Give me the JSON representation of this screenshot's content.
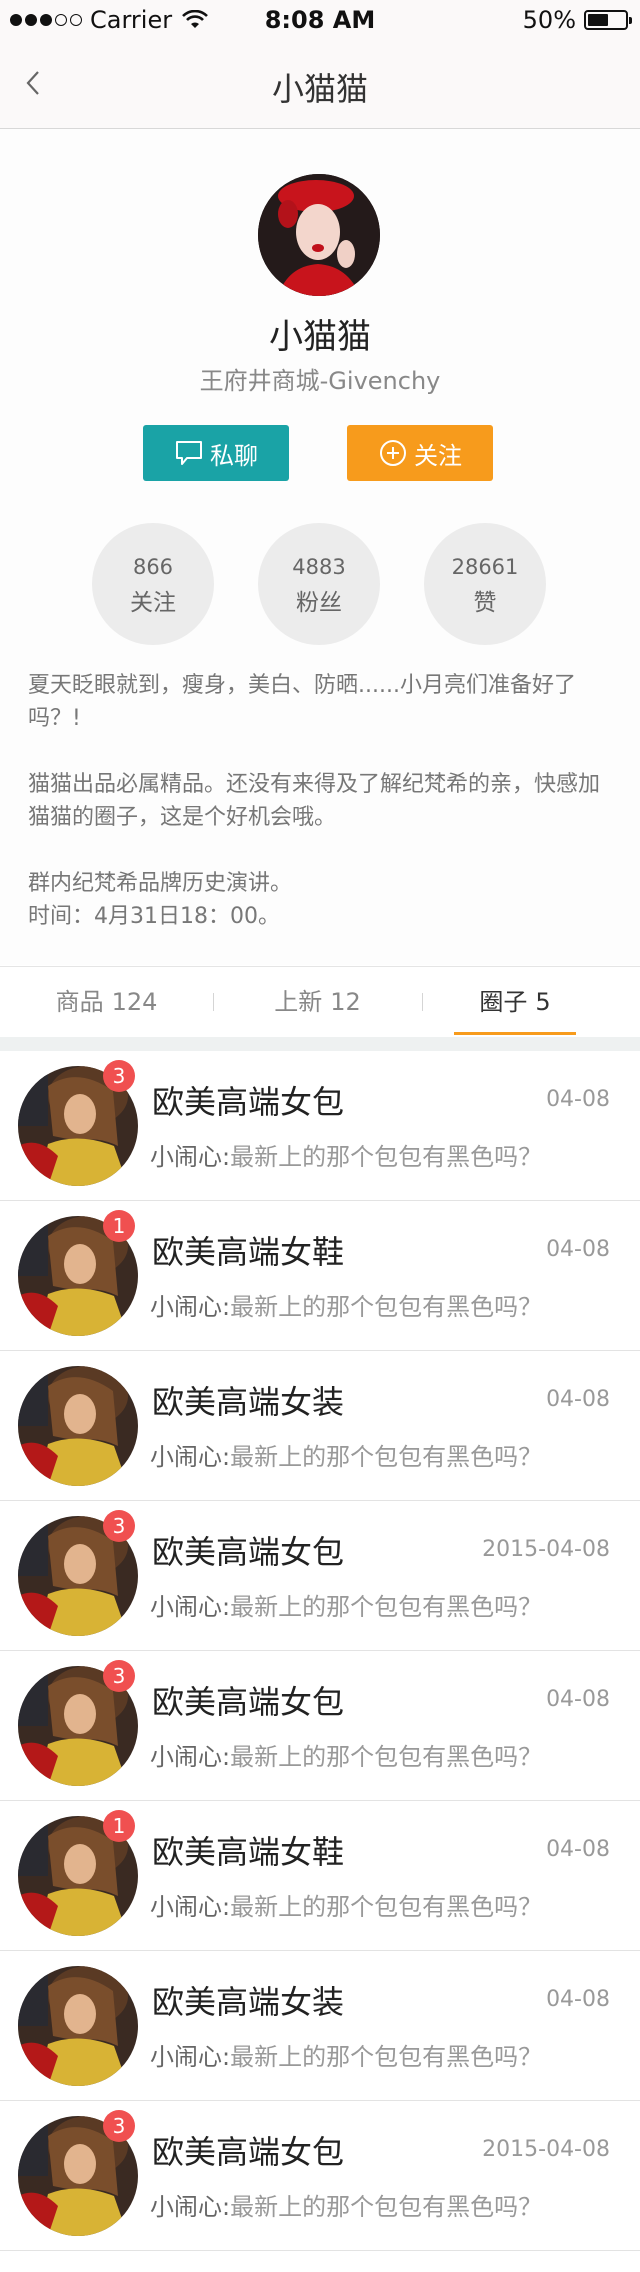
{
  "status_bar": {
    "carrier": "Carrier",
    "time": "8:08 AM",
    "battery": "50%"
  },
  "nav": {
    "title": "小猫猫"
  },
  "profile": {
    "name": "小猫猫",
    "subtitle": "王府井商城-Givenchy",
    "chat_label": "私聊",
    "follow_label": "关注",
    "stats": [
      {
        "value": "866",
        "label": "关注"
      },
      {
        "value": "4883",
        "label": "粉丝"
      },
      {
        "value": "28661",
        "label": "赞"
      }
    ],
    "bio": [
      "夏天眨眼就到，瘦身，美白、防晒......小月亮们准备好了吗？!",
      "猫猫出品必属精品。还没有来得及了解纪梵希的亲，快感加猫猫的圈子，这是个好机会哦。",
      "群内纪梵希品牌历史演讲。",
      "时间：4月31日18：00。"
    ]
  },
  "tabs": [
    {
      "label": "商品",
      "count": "124"
    },
    {
      "label": "上新",
      "count": "12"
    },
    {
      "label": "圈子",
      "count": "5"
    }
  ],
  "list": [
    {
      "title": "欧美高端女包",
      "date": "04-08",
      "sender": "小闹心:",
      "message": "最新上的那个包包有黑色吗？",
      "badge": "3"
    },
    {
      "title": "欧美高端女鞋",
      "date": "04-08",
      "sender": "小闹心:",
      "message": "最新上的那个包包有黑色吗？",
      "badge": "1"
    },
    {
      "title": "欧美高端女装",
      "date": "04-08",
      "sender": "小闹心:",
      "message": "最新上的那个包包有黑色吗？",
      "badge": ""
    },
    {
      "title": "欧美高端女包",
      "date": "2015-04-08",
      "sender": "小闹心:",
      "message": "最新上的那个包包有黑色吗？",
      "badge": "3"
    },
    {
      "title": "欧美高端女包",
      "date": "04-08",
      "sender": "小闹心:",
      "message": "最新上的那个包包有黑色吗？",
      "badge": "3"
    },
    {
      "title": "欧美高端女鞋",
      "date": "04-08",
      "sender": "小闹心:",
      "message": "最新上的那个包包有黑色吗？",
      "badge": "1"
    },
    {
      "title": "欧美高端女装",
      "date": "04-08",
      "sender": "小闹心:",
      "message": "最新上的那个包包有黑色吗？",
      "badge": ""
    },
    {
      "title": "欧美高端女包",
      "date": "2015-04-08",
      "sender": "小闹心:",
      "message": "最新上的那个包包有黑色吗？",
      "badge": "3"
    }
  ],
  "colors": {
    "teal": "#1aa3a6",
    "orange": "#f79b1c",
    "badge_red": "#f05050"
  },
  "icons": {
    "back": "chevron-left-icon",
    "chat": "chat-bubble-icon",
    "follow": "plus-circle-icon",
    "wifi": "wifi-icon",
    "battery": "battery-icon"
  }
}
